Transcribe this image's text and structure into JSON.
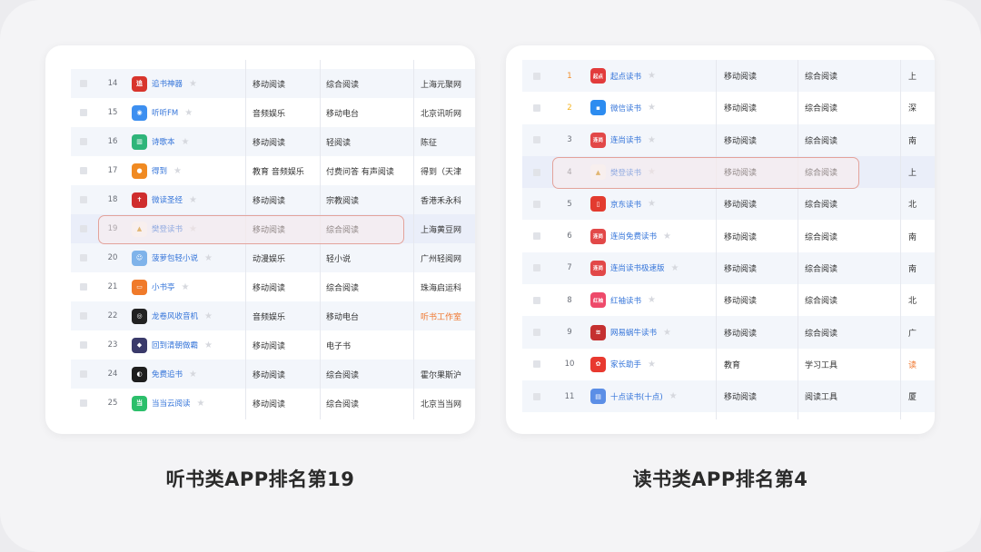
{
  "left": {
    "caption": "听书类APP排名第19",
    "highlight_rank": "19",
    "rows": [
      {
        "rank": "14",
        "name": "追书神器",
        "cat1": "移动阅读",
        "cat2": "综合阅读",
        "dev": "上海元聚网",
        "icon": "zhuishu-app-icon",
        "color": "#d8352c",
        "glyph": "追"
      },
      {
        "rank": "15",
        "name": "听听FM",
        "cat1": "音频娱乐",
        "cat2": "移动电台",
        "dev": "北京讯听网",
        "icon": "tingting-fm-app-icon",
        "color": "#3d8ff0",
        "glyph": "◉"
      },
      {
        "rank": "16",
        "name": "诗歌本",
        "cat1": "移动阅读",
        "cat2": "轻阅读",
        "dev": "陈征",
        "icon": "shigeben-app-icon",
        "color": "#2fb57a",
        "glyph": "▥"
      },
      {
        "rank": "17",
        "name": "得到",
        "cat1": "教育 音频娱乐",
        "cat2": "付费问答 有声阅读",
        "dev": "得到（天津",
        "icon": "dedao-app-icon",
        "color": "#f08a22",
        "glyph": "●"
      },
      {
        "rank": "18",
        "name": "微读圣经",
        "cat1": "移动阅读",
        "cat2": "宗教阅读",
        "dev": "香港禾永科",
        "icon": "weidu-bible-app-icon",
        "color": "#cf2e2e",
        "glyph": "✝"
      },
      {
        "rank": "19",
        "name": "樊登读书",
        "cat1": "移动阅读",
        "cat2": "综合阅读",
        "dev": "上海黄豆网",
        "icon": "fandeng-app-icon",
        "color": "#f2f2f2",
        "glyph": "▲",
        "glyphColor": "#c98a12"
      },
      {
        "rank": "20",
        "name": "菠萝包轻小说",
        "cat1": "动漫娱乐",
        "cat2": "轻小说",
        "dev": "广州轻阅网",
        "icon": "boluobao-app-icon",
        "color": "#7fb3ea",
        "glyph": "☺"
      },
      {
        "rank": "21",
        "name": "小书亭",
        "cat1": "移动阅读",
        "cat2": "综合阅读",
        "dev": "珠海启运科",
        "icon": "xiaoshuting-app-icon",
        "color": "#f07a2a",
        "glyph": "▭"
      },
      {
        "rank": "22",
        "name": "龙卷风收音机",
        "cat1": "音频娱乐",
        "cat2": "移动电台",
        "dev": "听书工作室",
        "icon": "longjuanfeng-app-icon",
        "color": "#222222",
        "glyph": "◎",
        "devOrange": true
      },
      {
        "rank": "23",
        "name": "回到清朝做霸",
        "cat1": "移动阅读",
        "cat2": "电子书",
        "dev": "",
        "icon": "huidaoqingchao-app-icon",
        "color": "#3a3a6a",
        "glyph": "◆"
      },
      {
        "rank": "24",
        "name": "免费追书",
        "cat1": "移动阅读",
        "cat2": "综合阅读",
        "dev": "霍尔果斯沪",
        "icon": "mianfei-zhuishu-app-icon",
        "color": "#1e1e1e",
        "glyph": "◐"
      },
      {
        "rank": "25",
        "name": "当当云阅读",
        "cat1": "移动阅读",
        "cat2": "综合阅读",
        "dev": "北京当当网",
        "icon": "dangdang-app-icon",
        "color": "#2cbf6b",
        "glyph": "当"
      }
    ]
  },
  "right": {
    "caption": "读书类APP排名第4",
    "highlight_rank": "4",
    "rows": [
      {
        "rank": "1",
        "name": "起点读书",
        "cat1": "移动阅读",
        "cat2": "综合阅读",
        "dev": "上",
        "icon": "qidian-app-icon",
        "color": "#e23b3b",
        "glyph": "起点",
        "rankClass": "r1"
      },
      {
        "rank": "2",
        "name": "微信读书",
        "cat1": "移动阅读",
        "cat2": "综合阅读",
        "dev": "深",
        "icon": "weixin-dushu-app-icon",
        "color": "#2d8cf0",
        "glyph": "▪",
        "rankClass": "r2"
      },
      {
        "rank": "3",
        "name": "连尚读书",
        "cat1": "移动阅读",
        "cat2": "综合阅读",
        "dev": "南",
        "icon": "lianshang-app-icon",
        "color": "#e24848",
        "glyph": "连尚"
      },
      {
        "rank": "4",
        "name": "樊登读书",
        "cat1": "移动阅读",
        "cat2": "综合阅读",
        "dev": "上",
        "icon": "fandeng-app-icon",
        "color": "#f2f2f2",
        "glyph": "▲",
        "glyphColor": "#c98a12"
      },
      {
        "rank": "5",
        "name": "京东读书",
        "cat1": "移动阅读",
        "cat2": "综合阅读",
        "dev": "北",
        "icon": "jingdong-dushu-app-icon",
        "color": "#e33b2f",
        "glyph": "▯"
      },
      {
        "rank": "6",
        "name": "连尚免费读书",
        "cat1": "移动阅读",
        "cat2": "综合阅读",
        "dev": "南",
        "icon": "lianshang-mianfei-app-icon",
        "color": "#e24848",
        "glyph": "连尚"
      },
      {
        "rank": "7",
        "name": "连尚读书极速版",
        "cat1": "移动阅读",
        "cat2": "综合阅读",
        "dev": "南",
        "icon": "lianshang-jisu-app-icon",
        "color": "#e24848",
        "glyph": "连尚"
      },
      {
        "rank": "8",
        "name": "红袖读书",
        "cat1": "移动阅读",
        "cat2": "综合阅读",
        "dev": "北",
        "icon": "hongxiu-app-icon",
        "color": "#ee4a6a",
        "glyph": "红袖"
      },
      {
        "rank": "9",
        "name": "网易蜗牛读书",
        "cat1": "移动阅读",
        "cat2": "综合阅读",
        "dev": "广",
        "icon": "wangyi-woniu-app-icon",
        "color": "#c53030",
        "glyph": "≋"
      },
      {
        "rank": "10",
        "name": "家长助手",
        "cat1": "教育",
        "cat2": "学习工具",
        "dev": "读",
        "icon": "jiazhang-zhushou-app-icon",
        "color": "#e8392f",
        "glyph": "✿",
        "devOrange": true
      },
      {
        "rank": "11",
        "name": "十点读书(十点)",
        "cat1": "移动阅读",
        "cat2": "阅读工具",
        "dev": "厦",
        "icon": "shidian-app-icon",
        "color": "#5b8ee6",
        "glyph": "▤"
      }
    ]
  }
}
